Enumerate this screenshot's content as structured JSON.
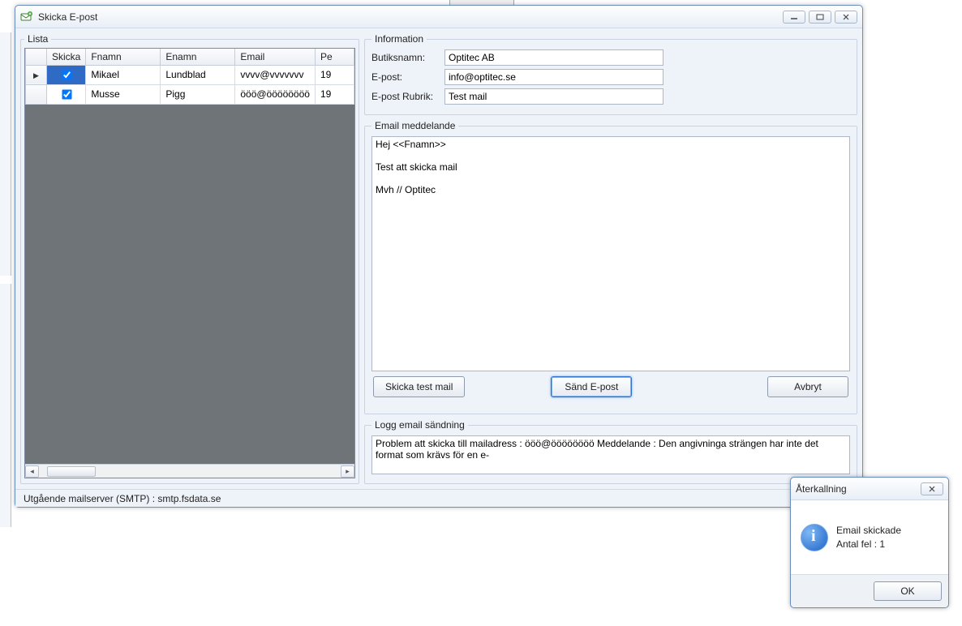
{
  "window": {
    "title": "Skicka E-post",
    "statusbar": "Utgående mailserver (SMTP) : smtp.fsdata.se"
  },
  "lista": {
    "legend": "Lista",
    "headers": {
      "skicka": "Skicka",
      "fnamn": "Fnamn",
      "enamn": "Enamn",
      "email": "Email",
      "last": "Pe"
    },
    "rows": [
      {
        "active": true,
        "skicka": true,
        "fnamn": "Mikael",
        "enamn": "Lundblad",
        "email": "vvvv@vvvvvvv",
        "last": "19"
      },
      {
        "active": false,
        "skicka": true,
        "fnamn": "Musse",
        "enamn": "Pigg",
        "email": "ööö@öööööööö",
        "last": "19"
      }
    ]
  },
  "info": {
    "legend": "Information",
    "butiksnamn_label": "Butiksnamn:",
    "butiksnamn": "Optitec AB",
    "epost_label": "E-post:",
    "epost": "info@optitec.se",
    "rubrik_label": "E-post Rubrik:",
    "rubrik": "Test mail"
  },
  "message": {
    "legend": "Email meddelande",
    "body": "Hej <<Fnamn>>\n\nTest att skicka mail\n\nMvh // Optitec"
  },
  "buttons": {
    "test": "Skicka test mail",
    "send": "Sänd E-post",
    "cancel": "Avbryt"
  },
  "log": {
    "legend": "Logg email sändning",
    "text": "Problem att skicka till mailadress : ööö@öööööööö Meddelande : Den angivninga strängen har inte det format som krävs för en e-"
  },
  "popup": {
    "title": "Återkallning",
    "line1": "Email skickade",
    "line2": "Antal fel : 1",
    "ok": "OK"
  }
}
